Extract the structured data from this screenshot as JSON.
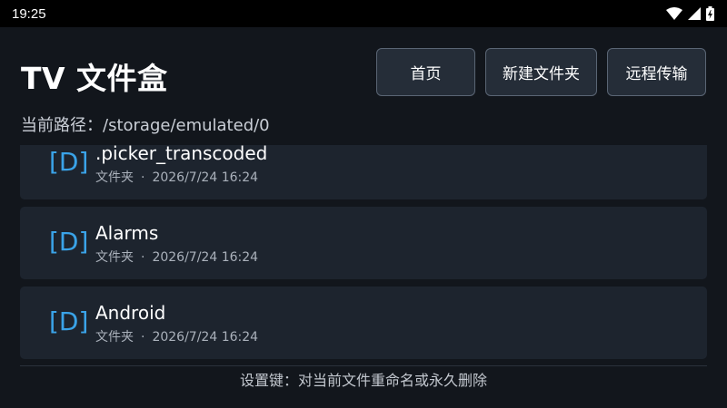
{
  "status_bar": {
    "time": "19:25",
    "icons": [
      "wifi-icon",
      "cell-signal-icon",
      "battery-charging-icon"
    ]
  },
  "header": {
    "title": "TV 文件盒",
    "buttons": {
      "home": "首页",
      "new_folder": "新建文件夹",
      "remote_transfer": "远程传输"
    }
  },
  "path": {
    "label": "当前路径：",
    "value": "/storage/emulated/0"
  },
  "files": [
    {
      "tag": "[D]",
      "name": ".picker_transcoded",
      "type": "文件夹",
      "separator": "·",
      "date": "2026/7/24 16:24"
    },
    {
      "tag": "[D]",
      "name": "Alarms",
      "type": "文件夹",
      "separator": "·",
      "date": "2026/7/24 16:24"
    },
    {
      "tag": "[D]",
      "name": "Android",
      "type": "文件夹",
      "separator": "·",
      "date": "2026/7/24 16:24"
    }
  ],
  "footer": {
    "hint": "设置键：对当前文件重命名或永久删除"
  },
  "colors": {
    "background": "#12161c",
    "row_background": "#1d242e",
    "button_background": "#252d38",
    "folder_tag": "#3aa3e8"
  }
}
